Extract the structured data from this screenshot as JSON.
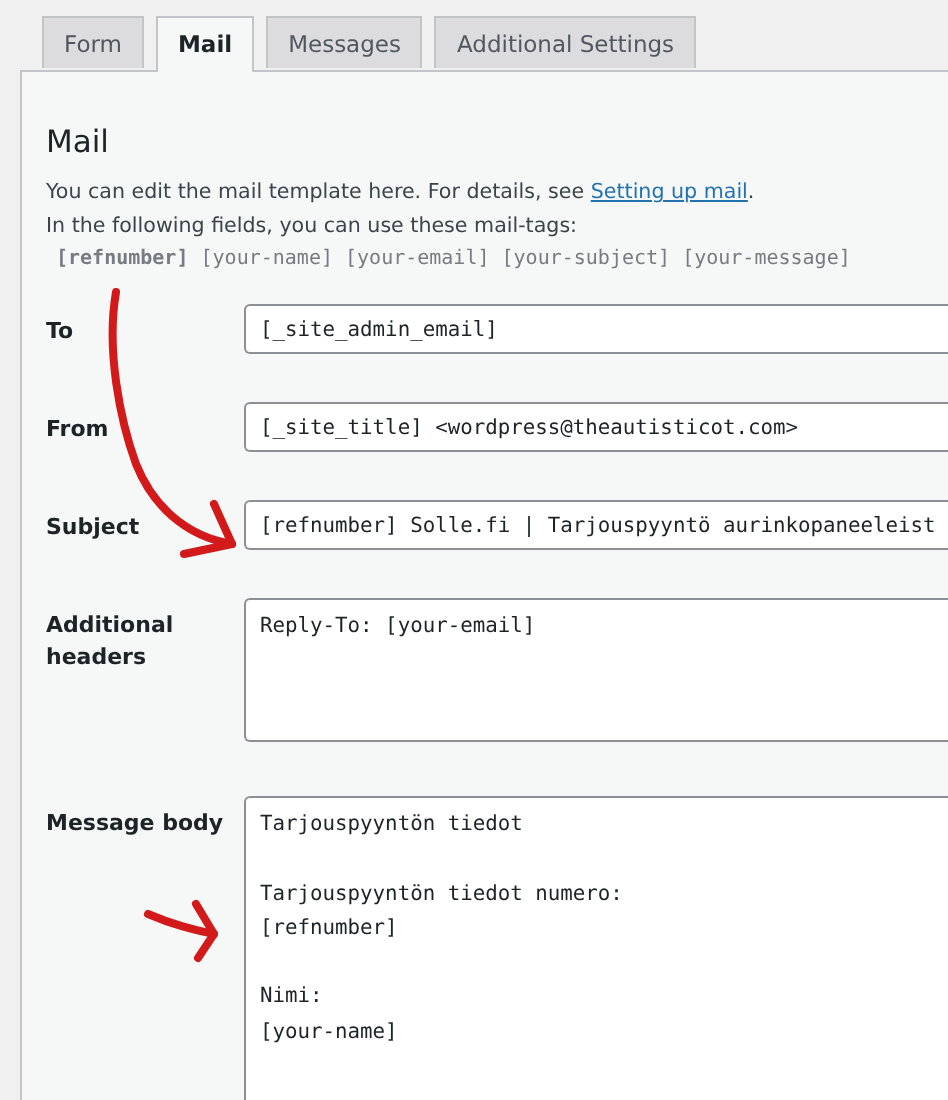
{
  "tabs": [
    {
      "label": "Form",
      "selected": false
    },
    {
      "label": "Mail",
      "selected": true
    },
    {
      "label": "Messages",
      "selected": false
    },
    {
      "label": "Additional Settings",
      "selected": false
    }
  ],
  "panel": {
    "heading": "Mail",
    "description": {
      "text": "You can edit the mail template here. For details, see ",
      "link": "Setting up mail",
      "after": "."
    },
    "tags_intro": "In the following fields, you can use these mail-tags:",
    "mail_tags": "**[refnumber]** [your-name] [your-email] [your-subject] [your-message]",
    "fields": [
      {
        "label": "To",
        "kind": "input",
        "value": "[_site_admin_email]"
      },
      {
        "label": "From",
        "kind": "input",
        "value": "[_site_title] <wordpress@theautisticot.com>"
      },
      {
        "label": "Subject",
        "kind": "input",
        "value": "[refnumber] Solle.fi | Tarjouspyyntö aurinkopaneeleist"
      },
      {
        "label": "Additional headers",
        "kind": "textarea",
        "value": "Reply-To: [your-email]"
      },
      {
        "label": "Message body",
        "kind": "body",
        "value": "Tarjouspyyntön tiedot\n\nTarjouspyyntön tiedot numero:\n[refnumber]\n\nNimi:\n[your-name]"
      }
    ]
  }
}
